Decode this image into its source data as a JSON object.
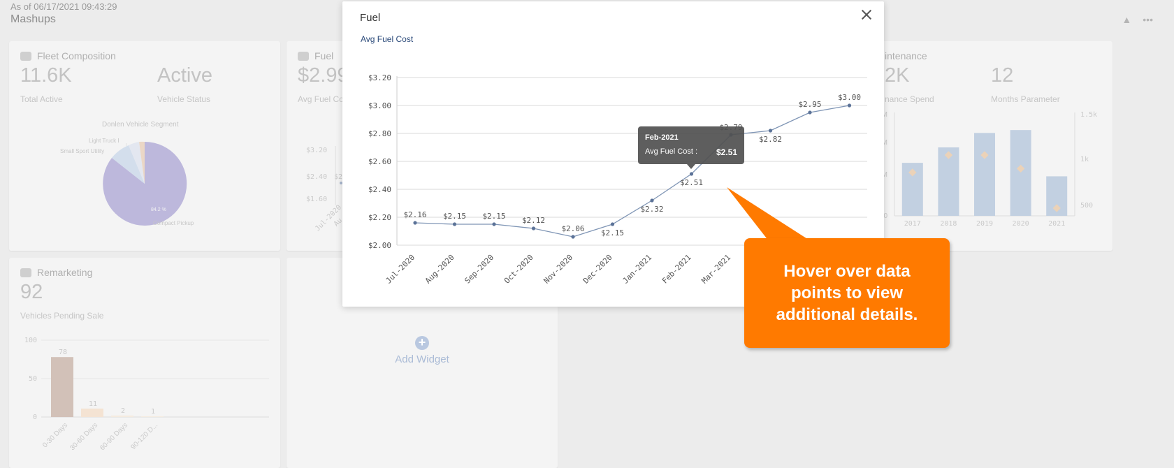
{
  "header": {
    "as_of": "As of 06/17/2021 09:43:29",
    "title": "Mashups"
  },
  "header_icons": [
    "collapse-icon",
    "more-icon"
  ],
  "fleet": {
    "title": "Fleet Composition",
    "kpi1_value": "11.6K",
    "kpi1_label": "Total Active",
    "kpi2_value": "Active",
    "kpi2_label": "Vehicle Status",
    "pie_title": "Donlen Vehicle Segment",
    "pie_labels": [
      "Light Truck I",
      "Small Sport Utility",
      "Compact Pickup"
    ],
    "pie_pct": "84.2 %"
  },
  "fuel_card": {
    "title": "Fuel",
    "kpi_value": "$2.99",
    "kpi_label": "Avg Fuel Co",
    "ticks": [
      "$3.20",
      "$2.40",
      "$1.60"
    ],
    "x_ticks": [
      "Jul-2020",
      "Au"
    ],
    "point_label": "$2"
  },
  "maintenance": {
    "title": "intenance",
    "kpi1_value": "2K",
    "kpi1_label": "nance Spend",
    "kpi2_value": "12",
    "kpi2_label": "Months Parameter",
    "left_ticks": [
      "M",
      "M",
      "M",
      "0"
    ],
    "right_ticks": [
      "1.5k",
      "1k",
      "500"
    ],
    "years": [
      "2017",
      "2018",
      "2019",
      "2020",
      "2021"
    ],
    "bars": [
      0.55,
      0.71,
      0.86,
      0.89,
      0.41
    ],
    "points": [
      0.45,
      0.63,
      0.63,
      0.49,
      0.08
    ]
  },
  "remarketing": {
    "title": "Remarketing",
    "kpi_value": "92",
    "kpi_label": "Vehicles Pending Sale",
    "y_ticks": [
      "100",
      "50",
      "0"
    ],
    "categories": [
      "0-30 Days",
      "30-60 Days",
      "60-90 Days",
      "90-120 D..."
    ],
    "values": [
      78,
      11,
      2,
      1
    ],
    "value_labels": [
      "78",
      "11",
      "2",
      "1"
    ]
  },
  "add_widget": {
    "icon": "plus-icon",
    "label": "Add Widget"
  },
  "modal": {
    "title": "Fuel",
    "subtitle": "Avg Fuel Cost",
    "close_icon": "close-icon"
  },
  "chart_data": {
    "type": "line",
    "title": "Avg Fuel Cost",
    "x": [
      "Jul-2020",
      "Aug-2020",
      "Sep-2020",
      "Oct-2020",
      "Nov-2020",
      "Dec-2020",
      "Jan-2021",
      "Feb-2021",
      "Mar-2021",
      "",
      "",
      ""
    ],
    "values": [
      2.16,
      2.15,
      2.15,
      2.12,
      2.06,
      2.15,
      2.32,
      2.51,
      2.79,
      2.82,
      2.95,
      3.0
    ],
    "data_labels": [
      "$2.16",
      "$2.15",
      "$2.15",
      "$2.12",
      "$2.06",
      "$2.15",
      "$2.32",
      "$2.51",
      "$2.79",
      "$2.82",
      "$2.95",
      "$3.00"
    ],
    "y_ticks": [
      "$3.20",
      "$3.00",
      "$2.80",
      "$2.60",
      "$2.40",
      "$2.20",
      "$2.00"
    ],
    "ylim": [
      2.0,
      3.2
    ],
    "grid": true,
    "line_color": "#7f95b5"
  },
  "tooltip": {
    "title": "Feb-2021",
    "label": "Avg Fuel Cost :",
    "value": "$2.51"
  },
  "callout": {
    "text": "Hover over data points to view additional details.",
    "color": "#ff7a00"
  }
}
